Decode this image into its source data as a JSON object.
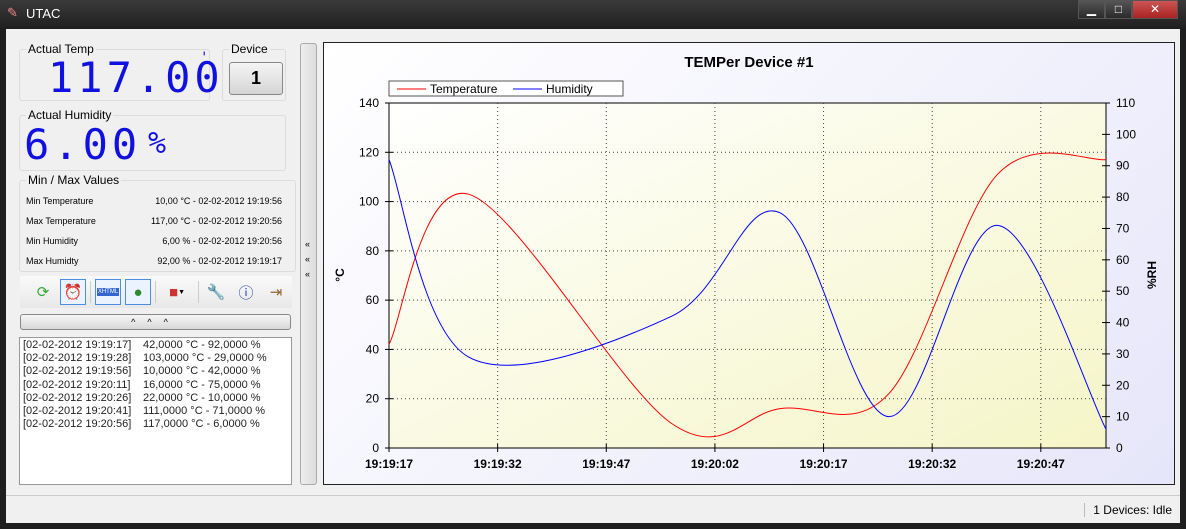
{
  "window": {
    "title": "UTAC",
    "minimize": "▁",
    "maximize": "□",
    "close": "✕"
  },
  "actual_temp": {
    "label": "Actual Temp",
    "value": "117.00",
    "unit": "'"
  },
  "device": {
    "label": "Device",
    "value": "1"
  },
  "actual_humidity": {
    "label": "Actual Humidity",
    "value": "6.00",
    "unit": "%"
  },
  "minmax": {
    "label": "Min / Max Values",
    "rows": [
      {
        "label": "Min Temperature",
        "value": "10,00 °C - 02-02-2012 19:19:56"
      },
      {
        "label": "Max Temperature",
        "value": "117,00 °C - 02-02-2012 19:20:56"
      },
      {
        "label": "Min Humidity",
        "value": "6,00 % - 02-02-2012 19:20:56"
      },
      {
        "label": "Max Humidty",
        "value": "92,00 % - 02-02-2012 19:19:17"
      }
    ]
  },
  "toolbar": {
    "icons": [
      "refresh-icon",
      "alarm-clock-icon",
      "html-icon",
      "globe-icon",
      "cubes-icon",
      "wrench-icon",
      "info-icon",
      "exit-icon"
    ],
    "collapse": "^^^"
  },
  "log": [
    {
      "time": "[02-02-2012 19:19:17]",
      "value": "42,0000 °C - 92,0000 %"
    },
    {
      "time": "[02-02-2012 19:19:28]",
      "value": "103,0000 °C - 29,0000 %"
    },
    {
      "time": "[02-02-2012 19:19:56]",
      "value": "10,0000 °C - 42,0000 %"
    },
    {
      "time": "[02-02-2012 19:20:11]",
      "value": "16,0000 °C - 75,0000 %"
    },
    {
      "time": "[02-02-2012 19:20:26]",
      "value": "22,0000 °C - 10,0000 %"
    },
    {
      "time": "[02-02-2012 19:20:41]",
      "value": "111,0000 °C - 71,0000 %"
    },
    {
      "time": "[02-02-2012 19:20:56]",
      "value": "117,0000 °C - 6,0000 %"
    }
  ],
  "splitter": {
    "arrows": "«"
  },
  "status": "1 Devices: Idle",
  "chart_data": {
    "type": "line",
    "title": "TEMPer Device #1",
    "ylabel": "°C",
    "y2label": "%RH",
    "ylim": [
      0,
      140
    ],
    "y2lim": [
      0,
      110
    ],
    "yticks": [
      "0",
      "20",
      "40",
      "60",
      "80",
      "100",
      "120",
      "140"
    ],
    "y2ticks": [
      "0",
      "10",
      "20",
      "30",
      "40",
      "50",
      "60",
      "70",
      "80",
      "90",
      "100",
      "110"
    ],
    "xticks": [
      "19:19:17",
      "19:19:32",
      "19:19:47",
      "19:20:02",
      "19:20:17",
      "19:20:32",
      "19:20:47"
    ],
    "x_seconds": [
      0,
      11,
      39,
      54,
      69,
      84,
      99
    ],
    "xlim": [
      0,
      99
    ],
    "legend": "top-left",
    "grid": true,
    "series": [
      {
        "name": "Temperature",
        "axis": "left",
        "color": "#ff0000",
        "values": [
          42,
          103,
          10,
          16,
          22,
          111,
          117
        ]
      },
      {
        "name": "Humidity",
        "axis": "right",
        "color": "#0000ff",
        "values": [
          92,
          29,
          42,
          75,
          10,
          71,
          6
        ]
      }
    ]
  }
}
